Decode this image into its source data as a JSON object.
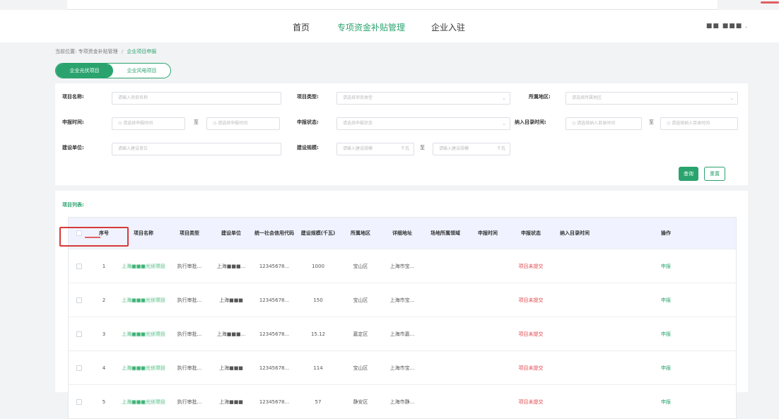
{
  "nav": {
    "items": [
      "首页",
      "专项资金补贴管理",
      "企业入驻"
    ],
    "user": "■■ ■■■ ."
  },
  "breadcrumb": {
    "prefix": "当前位置:",
    "level1": "专项资金补贴管理",
    "level2": "企业项目申报"
  },
  "tabs": [
    "企业光伏项目",
    "企业风电项目"
  ],
  "filters": {
    "project_name": {
      "label": "项目名称:",
      "placeholder": "请输入项目名称"
    },
    "project_type": {
      "label": "项目类型:",
      "placeholder": "请选择项目类型"
    },
    "region": {
      "label": "所属地区:",
      "placeholder": "请选择所属地区"
    },
    "apply_time": {
      "label": "申报时间:",
      "start_placeholder": "请选择申报时间",
      "end_placeholder": "请选择申报时间"
    },
    "apply_status": {
      "label": "申报状态:",
      "placeholder": "请选择申报状态"
    },
    "catalog_time": {
      "label": "纳入目录时间:",
      "start_placeholder": "请选择纳入目录时间",
      "end_placeholder": "请选择纳入目录时间"
    },
    "builder": {
      "label": "建设单位:",
      "placeholder": "请输入建设单位"
    },
    "scale": {
      "label": "建设规模:",
      "min_placeholder": "请输入建设规模",
      "max_placeholder": "请输入建设规模",
      "unit": "千瓦"
    },
    "range_sep": "至"
  },
  "buttons": {
    "query": "查询",
    "reset": "重置"
  },
  "list": {
    "title": "项目列表:",
    "columns": [
      "序号",
      "项目名称",
      "项目类型",
      "建设单位",
      "统一社会信用代码",
      "建设规模(千瓦)",
      "所属地区",
      "详细地址",
      "场地所属领域",
      "申报时间",
      "申报状态",
      "纳入目录时间",
      "操作"
    ],
    "rows": [
      {
        "no": "1",
        "name": "上海■■■光伏项目",
        "type": "执行审批...",
        "builder": "上海■■■...",
        "code": "12345678...",
        "scale": "1000",
        "region": "宝山区",
        "address": "上海市宝...",
        "field": "",
        "time": "",
        "status": "项目未提交",
        "catalog": "",
        "op": "申报"
      },
      {
        "no": "2",
        "name": "上海■■■光伏项目",
        "type": "执行审批...",
        "builder": "上海■■■",
        "code": "12345678...",
        "scale": "150",
        "region": "宝山区",
        "address": "上海市宝...",
        "field": "",
        "time": "",
        "status": "项目未提交",
        "catalog": "",
        "op": "申报"
      },
      {
        "no": "3",
        "name": "上海■■■光伏项目",
        "type": "执行审批...",
        "builder": "上海■■■...",
        "code": "12345678...",
        "scale": "15.12",
        "region": "嘉定区",
        "address": "上海市嘉...",
        "field": "",
        "time": "",
        "status": "项目未提交",
        "catalog": "",
        "op": "申报"
      },
      {
        "no": "4",
        "name": "上海■■■光伏项目",
        "type": "执行审批...",
        "builder": "上海■■■",
        "code": "12345678...",
        "scale": "114",
        "region": "宝山区",
        "address": "上海市宝...",
        "field": "",
        "time": "",
        "status": "项目未提交",
        "catalog": "",
        "op": "申报"
      },
      {
        "no": "5",
        "name": "上海■■■光伏项目",
        "type": "执行审批...",
        "builder": "上海■■■",
        "code": "12345678...",
        "scale": "57",
        "region": "静安区",
        "address": "上海市静...",
        "field": "",
        "time": "",
        "status": "项目未提交",
        "catalog": "",
        "op": "申报"
      }
    ]
  },
  "colors": {
    "accent": "#2aa36e",
    "status_red": "#e0484d",
    "highlight": "#d63a3a"
  }
}
